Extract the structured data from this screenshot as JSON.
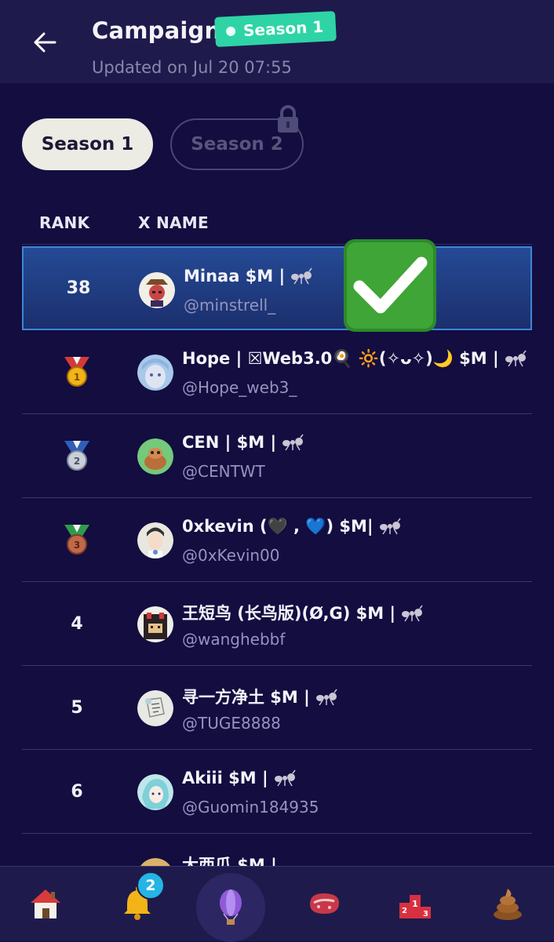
{
  "header": {
    "title": "Campaign",
    "badge": "Season 1",
    "updated": "Updated on Jul 20 07:55"
  },
  "tabs": [
    {
      "label": "Season 1",
      "active": true,
      "locked": false
    },
    {
      "label": "Season 2",
      "active": false,
      "locked": true
    }
  ],
  "table": {
    "columns": [
      "RANK",
      "X NAME"
    ],
    "rows": [
      {
        "rank": "38",
        "medal": null,
        "name": "Minaa $M |",
        "handle": "@minstrell_",
        "highlight": true,
        "avatar_color": "#c94545"
      },
      {
        "rank": "1",
        "medal": "gold-medal",
        "name": "Hope | ☒Web3.0🍳 🔆(✧ᴗ✧)🌙 $M |",
        "handle": "@Hope_web3_",
        "highlight": false,
        "avatar_color": "#a8c8ea"
      },
      {
        "rank": "2",
        "medal": "silver-medal",
        "name": "CEN | $M |",
        "handle": "@CENTWT",
        "highlight": false,
        "avatar_color": "#74c97a"
      },
      {
        "rank": "3",
        "medal": "bronze-medal",
        "name": "0xkevin (🖤 , 💙) $M|",
        "handle": "@0xKevin00",
        "highlight": false,
        "avatar_color": "#e9e7e0"
      },
      {
        "rank": "4",
        "medal": null,
        "name": "王短鸟 (长鸟版)(Ø,G) $M |",
        "handle": "@wanghebbf",
        "highlight": false,
        "avatar_color": "#2a2222"
      },
      {
        "rank": "5",
        "medal": null,
        "name": "寻一方净土 $M |",
        "handle": "@TUGE8888",
        "highlight": false,
        "avatar_color": "#e8e8e4"
      },
      {
        "rank": "6",
        "medal": null,
        "name": "Akiii $M |",
        "handle": "@Guomin184935",
        "highlight": false,
        "avatar_color": "#bfe6ea"
      },
      {
        "rank": "",
        "medal": null,
        "name": "大西瓜 $M |",
        "handle": "",
        "highlight": false,
        "avatar_color": "#d9b26a"
      }
    ]
  },
  "nav": {
    "items": [
      "home-icon",
      "bell-icon",
      "balloon-icon",
      "steak-icon",
      "podium-icon",
      "poop-icon"
    ],
    "notification_count": "2"
  },
  "colors": {
    "background": "#130d40",
    "accent": "#2ed4a5",
    "highlight": "#254a96"
  }
}
